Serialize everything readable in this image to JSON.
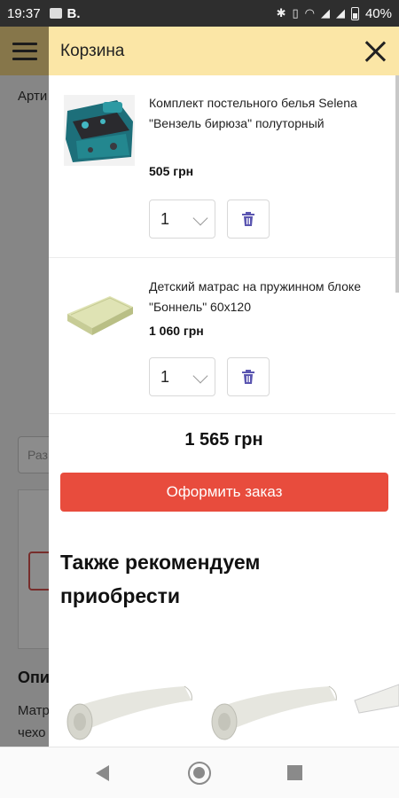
{
  "status_bar": {
    "time": "19:37",
    "app_letter": "B.",
    "battery": "40%"
  },
  "background_page": {
    "label_art": "Арти",
    "input_placeholder": "Раз",
    "heading": "Опи",
    "text_line1": "Матр",
    "text_line2": "чехо"
  },
  "cart": {
    "title": "Корзина",
    "items": [
      {
        "name": "Комплект постельного белья Selena \"Вензель бирюза\" полуторный",
        "price": "505 грн",
        "qty": "1"
      },
      {
        "name": "Детский матрас на пружинном блоке \"Боннель\" 60x120",
        "price": "1 060 грн",
        "qty": "1"
      }
    ],
    "total": "1 565 грн",
    "order_button": "Оформить заказ",
    "recommend_title": "Также рекомендуем приобрести"
  },
  "colors": {
    "header_bg": "#fbe6a6",
    "order_button": "#e84c3d",
    "delete_icon": "#5a55b0"
  },
  "icons": {
    "menu": "hamburger-icon",
    "close": "close-icon",
    "delete": "trash-icon",
    "dropdown": "chevron-down-icon"
  }
}
